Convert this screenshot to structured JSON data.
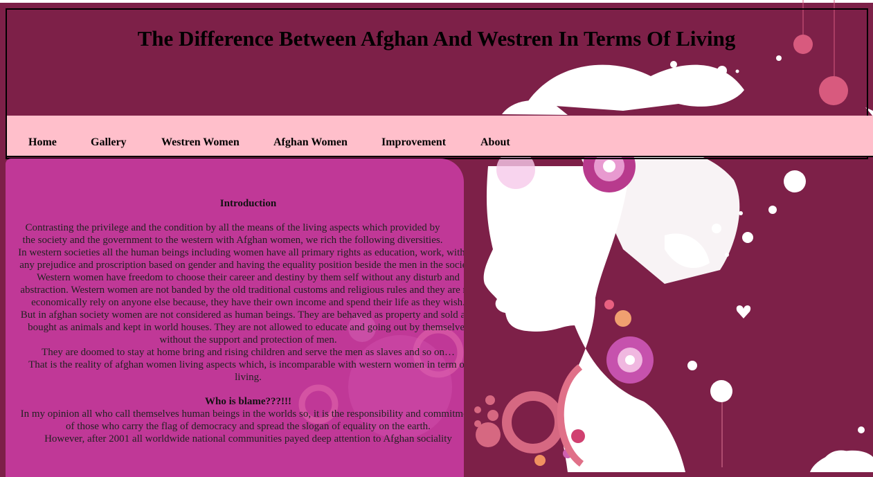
{
  "page": {
    "title": "The Difference Between Afghan And Westren In Terms Of Living"
  },
  "nav": {
    "items": [
      {
        "label": "Home"
      },
      {
        "label": "Gallery"
      },
      {
        "label": "Westren Women"
      },
      {
        "label": "Afghan Women"
      },
      {
        "label": "Improvement"
      },
      {
        "label": "About"
      }
    ]
  },
  "content": {
    "intro_heading": "Introduction",
    "paragraphs": [
      "Contrasting the privilege and the condition by all the means of the living aspects which provided by the society and the government to the western with Afghan women, we rich the following diversities.",
      "In western societies all the human beings including women have all primary rights as education, work, without any prejudice and proscription based on gender and having the equality position beside the men in the society. Western women have freedom to choose their career and destiny by them self without any disturb and abstraction. Western women are not banded by the old traditional customs and religious rules and they are not economically rely on anyone else because, they have their own income and spend their life as they wish.",
      "But in afghan society women are not considered as human beings. They are behaved as property and sold and bought as animals and kept in world houses. They are not allowed to educate and going out by themselves without the support and protection of men.",
      "They are doomed to stay at home bring and rising children and serve the men as slaves and so on…",
      "That is the reality of afghan women living aspects which, is incomparable with western women in term of living."
    ],
    "blame_heading": "Who is blame???!!!",
    "blame_paragraphs": [
      "In my opinion all who call themselves human beings in the worlds so, it is the responsibility and commitment of those who carry the flag of democracy and spread the slogan of equality on the earth.",
      "However,   after 2001 all worldwide national communities payed deep attention to Afghan sociality"
    ]
  },
  "colors": {
    "background": "#7d2048",
    "navbar": "#ffbfcb",
    "content_panel": "#c43a9c"
  },
  "decorations": [
    "woman-silhouette-illustration",
    "floral-swirl-decoration",
    "flower-icon"
  ]
}
